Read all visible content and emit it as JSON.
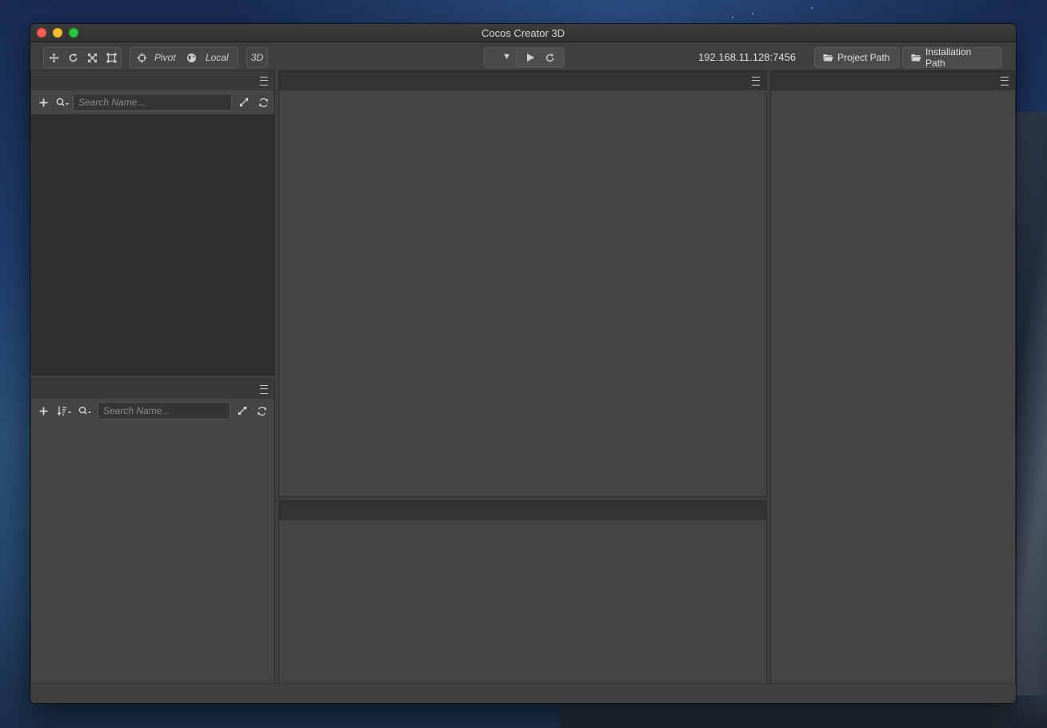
{
  "window": {
    "title": "Cocos Creator 3D"
  },
  "toolbar": {
    "pivot_label": "Pivot",
    "local_label": "Local",
    "mode_3d_label": "3D",
    "device_selector_value": "",
    "server_address": "192.168.11.128:7456",
    "project_path_label": "Project Path",
    "installation_path_label": "Installation Path"
  },
  "hierarchy_panel": {
    "search_placeholder": "Search Name..."
  },
  "assets_panel": {
    "search_placeholder": "Search Name..."
  },
  "icons": [
    "move-icon",
    "rotate-icon",
    "scale-icon",
    "rect-icon",
    "pivot-icon",
    "globe-icon",
    "play-icon",
    "refresh-icon",
    "folder-icon",
    "menu-icon",
    "plus-icon",
    "search-icon",
    "sort-icon",
    "expand-icon",
    "sync-icon"
  ]
}
